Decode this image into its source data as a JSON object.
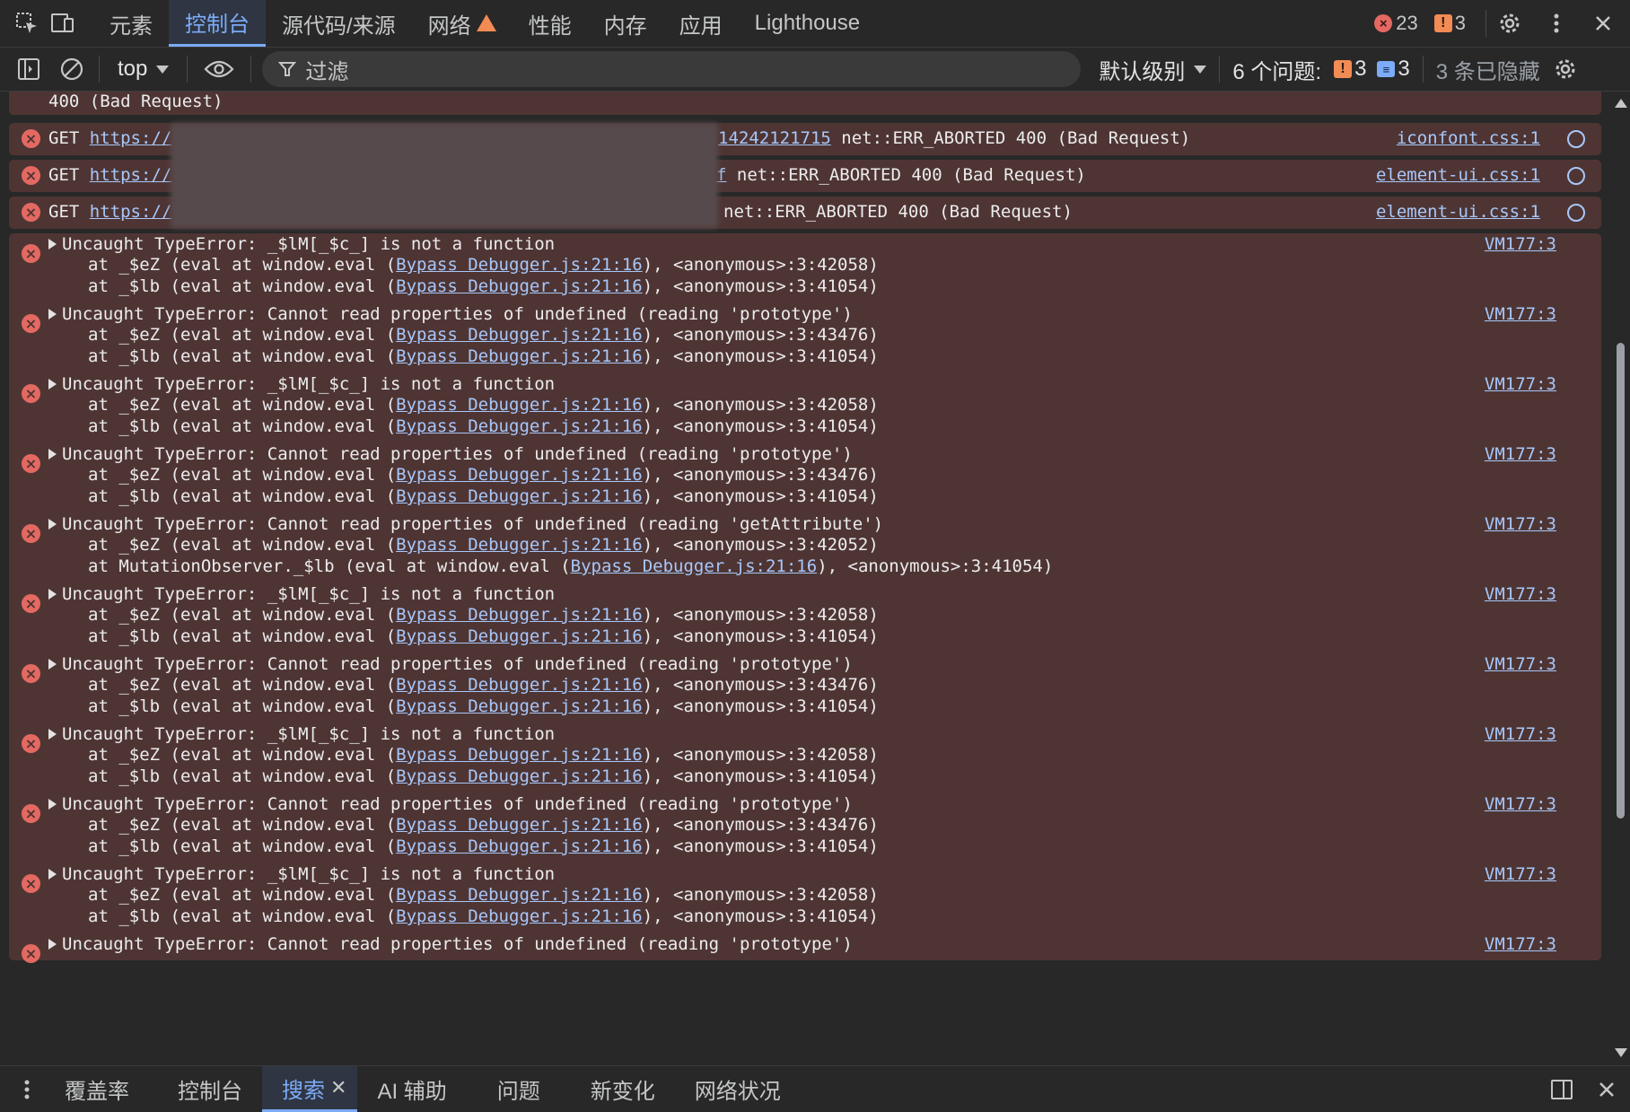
{
  "tabs": [
    {
      "label": "元素"
    },
    {
      "label": "控制台"
    },
    {
      "label": "源代码/来源"
    },
    {
      "label": "网络"
    },
    {
      "label": "性能"
    },
    {
      "label": "内存"
    },
    {
      "label": "应用"
    },
    {
      "label": "Lighthouse"
    }
  ],
  "active_tab": "控制台",
  "counts": {
    "errors": "23",
    "warnings": "3"
  },
  "filterbar": {
    "context": "top",
    "filter_placeholder": "过滤",
    "levels": "默认级别",
    "issues_label": "6 个问题:",
    "issues_warnings": "3",
    "issues_info": "3",
    "hidden": "3 条已隐藏"
  },
  "console": {
    "partial_top": "400 (Bad Request)",
    "network_rows": [
      {
        "prefix": "GET ",
        "url_start": "https://",
        "url_end": "14242121715",
        "rest": " net::ERR_ABORTED 400 (Bad Request)",
        "source": "iconfont.css:1"
      },
      {
        "prefix": "GET ",
        "url_start": "https://",
        "url_end": "f",
        "rest": " net::ERR_ABORTED 400 (Bad Request)",
        "source": "element-ui.css:1"
      },
      {
        "prefix": "GET ",
        "url_start": "https://",
        "url_end": "",
        "rest": "net::ERR_ABORTED 400 (Bad Request)",
        "source": "element-ui.css:1"
      }
    ],
    "errors": [
      {
        "message": "Uncaught TypeError: _$lM[_$c_] is not a function",
        "frames": [
          {
            "at": "at _$eZ (eval at window.eval (",
            "link": "Bypass Debugger.js:21:16",
            "tail": "), <anonymous>:3:42058)"
          },
          {
            "at": "at _$lb (eval at window.eval (",
            "link": "Bypass Debugger.js:21:16",
            "tail": "), <anonymous>:3:41054)"
          }
        ],
        "source": "VM177:3"
      },
      {
        "message": "Uncaught TypeError: Cannot read properties of undefined (reading 'prototype')",
        "frames": [
          {
            "at": "at _$eZ (eval at window.eval (",
            "link": "Bypass Debugger.js:21:16",
            "tail": "), <anonymous>:3:43476)"
          },
          {
            "at": "at _$lb (eval at window.eval (",
            "link": "Bypass Debugger.js:21:16",
            "tail": "), <anonymous>:3:41054)"
          }
        ],
        "source": "VM177:3"
      },
      {
        "message": "Uncaught TypeError: _$lM[_$c_] is not a function",
        "frames": [
          {
            "at": "at _$eZ (eval at window.eval (",
            "link": "Bypass Debugger.js:21:16",
            "tail": "), <anonymous>:3:42058)"
          },
          {
            "at": "at _$lb (eval at window.eval (",
            "link": "Bypass Debugger.js:21:16",
            "tail": "), <anonymous>:3:41054)"
          }
        ],
        "source": "VM177:3"
      },
      {
        "message": "Uncaught TypeError: Cannot read properties of undefined (reading 'prototype')",
        "frames": [
          {
            "at": "at _$eZ (eval at window.eval (",
            "link": "Bypass Debugger.js:21:16",
            "tail": "), <anonymous>:3:43476)"
          },
          {
            "at": "at _$lb (eval at window.eval (",
            "link": "Bypass Debugger.js:21:16",
            "tail": "), <anonymous>:3:41054)"
          }
        ],
        "source": "VM177:3"
      },
      {
        "message": "Uncaught TypeError: Cannot read properties of undefined (reading 'getAttribute')",
        "frames": [
          {
            "at": "at _$eZ (eval at window.eval (",
            "link": "Bypass Debugger.js:21:16",
            "tail": "), <anonymous>:3:42052)"
          },
          {
            "at": "at MutationObserver._$lb (eval at window.eval (",
            "link": "Bypass Debugger.js:21:16",
            "tail": "), <anonymous>:3:41054)"
          }
        ],
        "source": "VM177:3"
      },
      {
        "message": "Uncaught TypeError: _$lM[_$c_] is not a function",
        "frames": [
          {
            "at": "at _$eZ (eval at window.eval (",
            "link": "Bypass Debugger.js:21:16",
            "tail": "), <anonymous>:3:42058)"
          },
          {
            "at": "at _$lb (eval at window.eval (",
            "link": "Bypass Debugger.js:21:16",
            "tail": "), <anonymous>:3:41054)"
          }
        ],
        "source": "VM177:3"
      },
      {
        "message": "Uncaught TypeError: Cannot read properties of undefined (reading 'prototype')",
        "frames": [
          {
            "at": "at _$eZ (eval at window.eval (",
            "link": "Bypass Debugger.js:21:16",
            "tail": "), <anonymous>:3:43476)"
          },
          {
            "at": "at _$lb (eval at window.eval (",
            "link": "Bypass Debugger.js:21:16",
            "tail": "), <anonymous>:3:41054)"
          }
        ],
        "source": "VM177:3"
      },
      {
        "message": "Uncaught TypeError: _$lM[_$c_] is not a function",
        "frames": [
          {
            "at": "at _$eZ (eval at window.eval (",
            "link": "Bypass Debugger.js:21:16",
            "tail": "), <anonymous>:3:42058)"
          },
          {
            "at": "at _$lb (eval at window.eval (",
            "link": "Bypass Debugger.js:21:16",
            "tail": "), <anonymous>:3:41054)"
          }
        ],
        "source": "VM177:3"
      },
      {
        "message": "Uncaught TypeError: Cannot read properties of undefined (reading 'prototype')",
        "frames": [
          {
            "at": "at _$eZ (eval at window.eval (",
            "link": "Bypass Debugger.js:21:16",
            "tail": "), <anonymous>:3:43476)"
          },
          {
            "at": "at _$lb (eval at window.eval (",
            "link": "Bypass Debugger.js:21:16",
            "tail": "), <anonymous>:3:41054)"
          }
        ],
        "source": "VM177:3"
      },
      {
        "message": "Uncaught TypeError: _$lM[_$c_] is not a function",
        "frames": [
          {
            "at": "at _$eZ (eval at window.eval (",
            "link": "Bypass Debugger.js:21:16",
            "tail": "), <anonymous>:3:42058)"
          },
          {
            "at": "at _$lb (eval at window.eval (",
            "link": "Bypass Debugger.js:21:16",
            "tail": "), <anonymous>:3:41054)"
          }
        ],
        "source": "VM177:3"
      },
      {
        "message": "Uncaught TypeError: Cannot read properties of undefined (reading 'prototype')",
        "frames": [],
        "source": "VM177:3"
      }
    ]
  },
  "drawer": {
    "tabs": [
      {
        "label": "覆盖率"
      },
      {
        "label": "控制台"
      },
      {
        "label": "搜索"
      },
      {
        "label": "AI 辅助"
      },
      {
        "label": "问题"
      },
      {
        "label": "新变化"
      },
      {
        "label": "网络状况"
      }
    ],
    "active": "搜索"
  },
  "colors": {
    "error_row_bg": "#4e3534",
    "accent": "#7cacf8",
    "link": "#a8c7fa",
    "error": "#e46962",
    "warning": "#f28b54"
  },
  "icons": [
    "inspect-element-icon",
    "device-toolbar-icon",
    "warning-triangle-icon",
    "settings-gear-icon",
    "more-vertical-icon",
    "close-icon",
    "sidebar-toggle-icon",
    "clear-console-icon",
    "eye-icon",
    "filter-funnel-icon",
    "error-circle-icon",
    "network-request-icon",
    "dock-side-icon"
  ]
}
